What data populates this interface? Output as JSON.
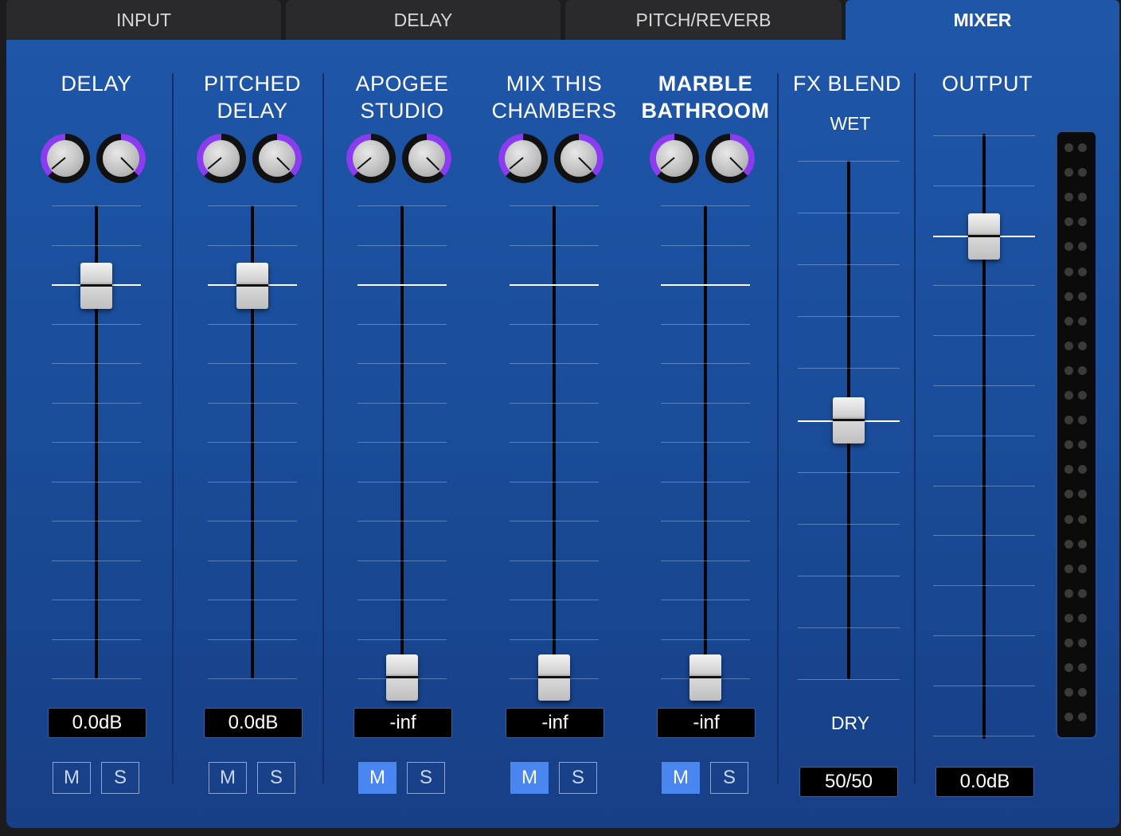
{
  "tabs": [
    {
      "label": "INPUT",
      "active": false
    },
    {
      "label": "DELAY",
      "active": false
    },
    {
      "label": "PITCH/REVERB",
      "active": false
    },
    {
      "label": "MIXER",
      "active": true
    }
  ],
  "channels": [
    {
      "title_lines": [
        "DELAY",
        ""
      ],
      "readout": "0.0dB",
      "mute": false,
      "solo": false,
      "fader_level": 0.17,
      "knob_left": "left",
      "knob_right": "right"
    },
    {
      "title_lines": [
        "PITCHED",
        "DELAY"
      ],
      "readout": "0.0dB",
      "mute": false,
      "solo": false,
      "fader_level": 0.17,
      "knob_left": "left",
      "knob_right": "right"
    },
    {
      "title_lines": [
        "APOGEE",
        "STUDIO"
      ],
      "readout": "-inf",
      "mute": true,
      "solo": false,
      "fader_level": 1.0,
      "knob_left": "left",
      "knob_right": "right"
    },
    {
      "title_lines": [
        "MIX THIS",
        "CHAMBERS"
      ],
      "readout": "-inf",
      "mute": true,
      "solo": false,
      "fader_level": 1.0,
      "knob_left": "left",
      "knob_right": "right"
    },
    {
      "title_lines": [
        "MARBLE",
        "BATHROOM"
      ],
      "readout": "-inf",
      "mute": true,
      "solo": false,
      "fader_level": 1.0,
      "knob_left": "left",
      "knob_right": "right"
    }
  ],
  "fx_blend": {
    "title": "FX BLEND",
    "wet_label": "WET",
    "dry_label": "DRY",
    "readout": "50/50",
    "level": 0.5
  },
  "output": {
    "title": "OUTPUT",
    "readout": "0.0dB",
    "level": 0.17
  },
  "buttons": {
    "mute": "M",
    "solo": "S"
  },
  "colors": {
    "panel": "#1e56a8",
    "accent_knob": "#8a3cf0",
    "button_on": "#4a86f0"
  }
}
